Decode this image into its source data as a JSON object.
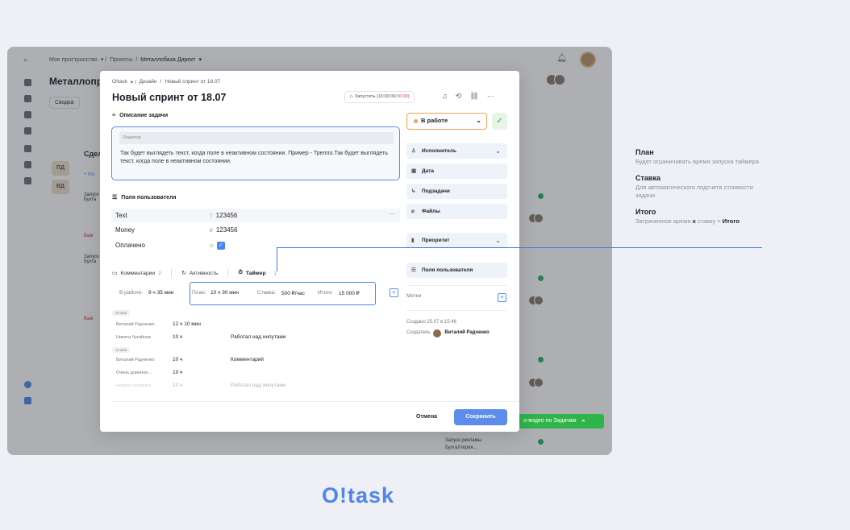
{
  "background_app": {
    "expand_icon": "double-chevron-right-icon",
    "breadcrumb": [
      "Мое пространство",
      "Проекты",
      "Металлобаза Директ"
    ],
    "title": "Металлопр",
    "tab_summary": "Сводка",
    "column_head": "Сдел",
    "add_task": "+ Но",
    "chips": [
      "ПД",
      "ВД"
    ],
    "card_text": "Запуск Бухга",
    "card_badge": "Важ",
    "toast_text": "о-видео по Задачам",
    "bottom_card": "Запуск рекламы Бухгалтерия..."
  },
  "modal": {
    "breadcrumb": [
      "O!task",
      "Дизайн",
      "Новый спринт от 18.07"
    ],
    "title": "Новый спринт от 18.07",
    "run_button": {
      "label": "Запустить (16:00:00/",
      "limit": "16:00)"
    },
    "description": {
      "label": "Описание задачи",
      "editor_hint": "Редактор",
      "text": "Так будет выглядеть текст, когда поле в неактивном состоянии. Пример - Трелло.Так будет выглядеть текст, когда поле в неактивном состоянии."
    },
    "custom_fields": {
      "label": "Поля пользователя",
      "rows": [
        {
          "name": "Text",
          "prefix": "T",
          "value": "123456"
        },
        {
          "name": "Money",
          "prefix": "₽",
          "value": "123456"
        },
        {
          "name": "Оплачено",
          "prefix": "⊙",
          "value": ""
        }
      ]
    },
    "tabs": {
      "comments": "Комментарии",
      "comments_count": "2",
      "activity": "Активность",
      "timer": "Таймер"
    },
    "timer": {
      "in_work_label": "В работе:",
      "in_work_value": "9 ч 35 мин",
      "plan_label": "План:",
      "plan_value": "10 ч 30 мин",
      "rate_label": "Ставка:",
      "rate_value": "500 ₽/час",
      "total_label": "Итого:",
      "total_value": "15 000 ₽"
    },
    "log": {
      "groups": [
        {
          "date": "15 мая",
          "rows": [
            {
              "who": "Виталий Радченко",
              "time": "12 ч 10 мин",
              "note": ""
            },
            {
              "who": "Никита Чугайнов",
              "time": "10 ч",
              "note": "Работал над инпутами"
            }
          ]
        },
        {
          "date": "14 мая",
          "rows": [
            {
              "who": "Виталий Радченко",
              "time": "10 ч",
              "note": "Комментарий"
            },
            {
              "who": "Очень длинное...",
              "time": "10 ч",
              "note": ""
            },
            {
              "who": "Никита Чугайнов",
              "time": "10 ч",
              "note": "Работал над инпутами"
            }
          ]
        }
      ]
    },
    "status": {
      "label": "В работе",
      "color": "#f0a25a"
    },
    "side": {
      "assignee": "Исполнитель",
      "date": "Дата",
      "subtasks": "Подзадачи",
      "files": "Файлы",
      "priority": "Приоритет",
      "custom_fields": "Поля пользователя",
      "labels": "Метки",
      "created": "Создано 25.07 в 15:46",
      "creator_label": "Создатель",
      "creator_name": "Виталий Радченко"
    },
    "buttons": {
      "cancel": "Отмена",
      "save": "Сохранить"
    }
  },
  "annotations": [
    {
      "title": "План",
      "text": "Будет ограничивать время запуска таймера"
    },
    {
      "title": "Ставка",
      "text": "Для автоматического подсчета стоимости задачи"
    },
    {
      "title": "Итого",
      "text_prefix": "Затраченное время",
      "x": "х",
      "mid": "ставку =",
      "bold": "Итого"
    }
  ],
  "brand": "O!task",
  "colors": {
    "accent": "#4f86e8",
    "status_orange": "#f0a25a",
    "success": "#2fb44a"
  }
}
